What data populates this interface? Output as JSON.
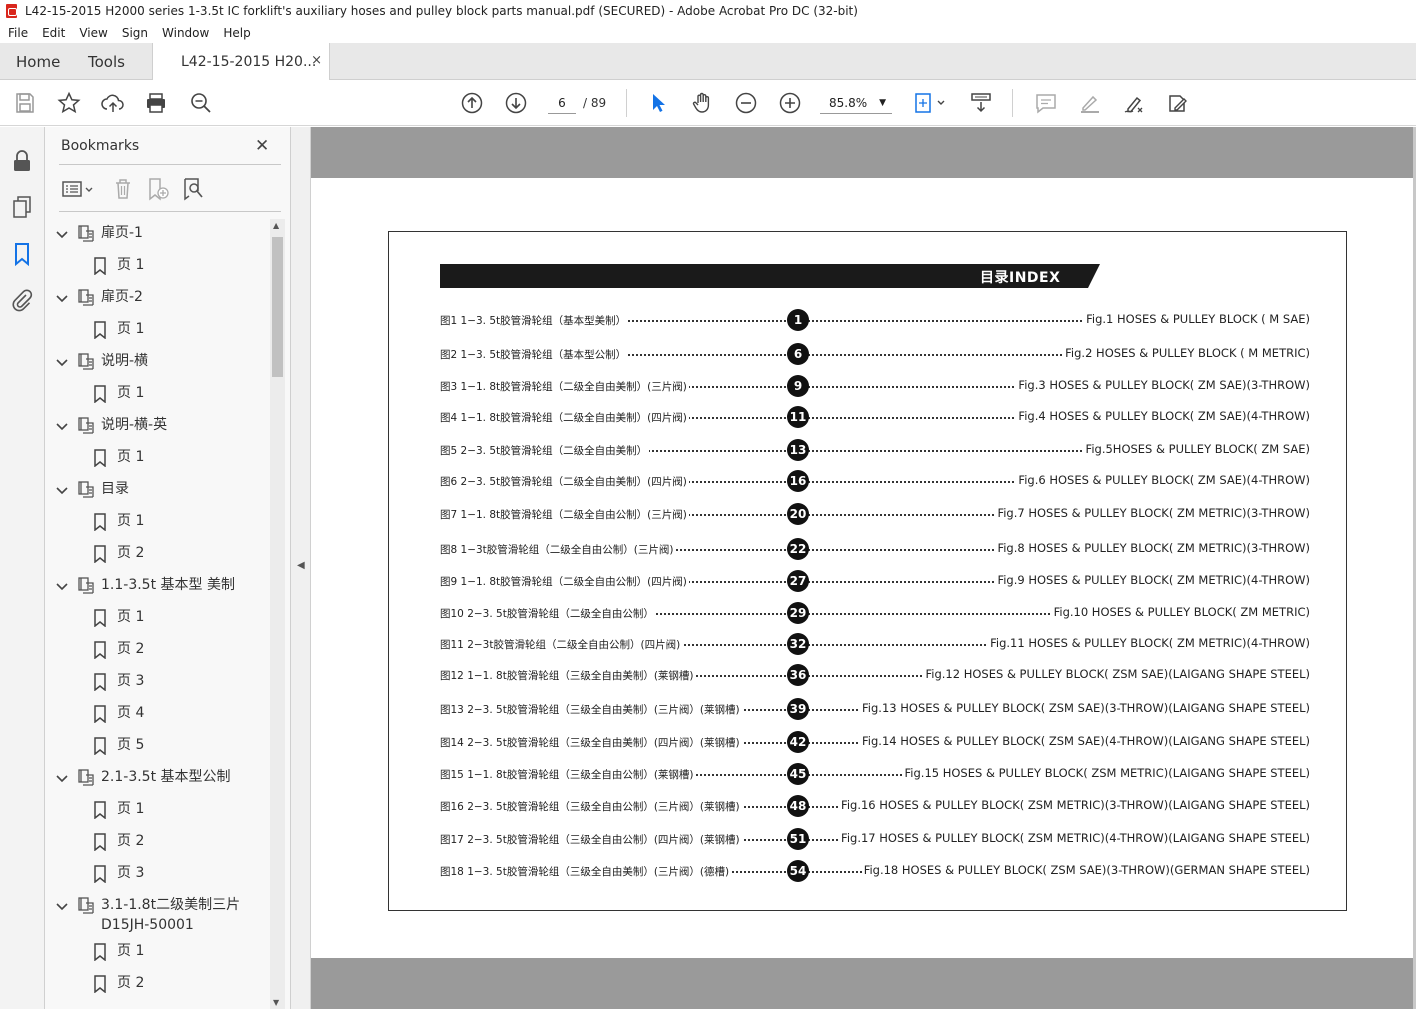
{
  "window": {
    "title": "L42-15-2015 H2000 series 1-3.5t IC forklift's auxiliary hoses and pulley block parts manual.pdf (SECURED) - Adobe Acrobat Pro DC (32-bit)"
  },
  "menu": [
    "File",
    "Edit",
    "View",
    "Sign",
    "Window",
    "Help"
  ],
  "tabs": {
    "home": "Home",
    "tools": "Tools",
    "document": "L42-15-2015 H20...",
    "close": "×"
  },
  "toolbar": {
    "page_current": "6",
    "page_total": "/ 89",
    "zoom": "85.8%"
  },
  "bookmarks": {
    "title": "Bookmarks",
    "items": [
      {
        "label": "扉页-1",
        "level": 0
      },
      {
        "label": "页 1",
        "level": 1
      },
      {
        "label": "扉页-2",
        "level": 0
      },
      {
        "label": "页 1",
        "level": 1
      },
      {
        "label": "说明-横",
        "level": 0
      },
      {
        "label": "页 1",
        "level": 1
      },
      {
        "label": "说明-横-英",
        "level": 0
      },
      {
        "label": "页 1",
        "level": 1
      },
      {
        "label": "目录",
        "level": 0
      },
      {
        "label": "页 1",
        "level": 1
      },
      {
        "label": "页 2",
        "level": 1
      },
      {
        "label": "1.1-3.5t 基本型 美制",
        "level": 0
      },
      {
        "label": "页 1",
        "level": 1
      },
      {
        "label": "页 2",
        "level": 1
      },
      {
        "label": "页 3",
        "level": 1
      },
      {
        "label": "页 4",
        "level": 1
      },
      {
        "label": "页 5",
        "level": 1
      },
      {
        "label": "2.1-3.5t 基本型公制",
        "level": 0
      },
      {
        "label": "页 1",
        "level": 1
      },
      {
        "label": "页 2",
        "level": 1
      },
      {
        "label": "页 3",
        "level": 1
      },
      {
        "label": "3.1-1.8t二级美制三片",
        "label2": "D15JH-50001",
        "level": 0
      },
      {
        "label": "页 1",
        "level": 1
      },
      {
        "label": "页 2",
        "level": 1
      }
    ]
  },
  "document": {
    "index_title": "目录INDEX",
    "entries": [
      {
        "cn": "图1  1−3. 5t胶管滑轮组（基本型美制）",
        "num": "1",
        "en": "Fig.1  HOSES & PULLEY BLOCK ( M SAE)"
      },
      {
        "cn": "图2  1−3. 5t胶管滑轮组（基本型公制）",
        "num": "6",
        "en": "Fig.2 HOSES & PULLEY BLOCK ( M METRIC)"
      },
      {
        "cn": "图3  1−1. 8t胶管滑轮组（二级全自由美制）(三片阀)",
        "num": "9",
        "en": "Fig.3 HOSES & PULLEY BLOCK( ZM SAE)(3-THROW)"
      },
      {
        "cn": "图4  1−1. 8t胶管滑轮组（二级全自由美制）(四片阀)",
        "num": "11",
        "en": "Fig.4 HOSES & PULLEY BLOCK( ZM SAE)(4-THROW)"
      },
      {
        "cn": "图5  2−3. 5t胶管滑轮组（二级全自由美制）",
        "num": "13",
        "en": "Fig.5HOSES & PULLEY BLOCK( ZM SAE)"
      },
      {
        "cn": "图6  2−3. 5t胶管滑轮组（二级全自由美制）(四片阀)",
        "num": "16",
        "en": "Fig.6 HOSES & PULLEY BLOCK( ZM SAE)(4-THROW)"
      },
      {
        "cn": "图7  1−1. 8t胶管滑轮组（二级全自由公制）(三片阀)",
        "num": "20",
        "en": "Fig.7 HOSES & PULLEY BLOCK( ZM METRIC)(3-THROW)"
      },
      {
        "cn": "图8  1−3t胶管滑轮组（二级全自由公制）(三片阀)",
        "num": "22",
        "en": "Fig.8 HOSES & PULLEY BLOCK( ZM METRIC)(3-THROW)"
      },
      {
        "cn": "图9  1−1. 8t胶管滑轮组（二级全自由公制）(四片阀)",
        "num": "27",
        "en": "Fig.9 HOSES & PULLEY BLOCK( ZM METRIC)(4-THROW)"
      },
      {
        "cn": "图10  2−3. 5t胶管滑轮组（二级全自由公制）",
        "num": "29",
        "en": "Fig.10 HOSES & PULLEY BLOCK( ZM METRIC)"
      },
      {
        "cn": "图11  2−3t胶管滑轮组（二级全自由公制）(四片阀)",
        "num": "32",
        "en": "Fig.11 HOSES & PULLEY BLOCK( ZM METRIC)(4-THROW)"
      },
      {
        "cn": "图12  1−1. 8t胶管滑轮组（三级全自由美制）(莱钢槽)",
        "num": "36",
        "en": "Fig.12 HOSES & PULLEY BLOCK( ZSM SAE)(LAIGANG SHAPE STEEL)"
      },
      {
        "cn": "图13  2−3. 5t胶管滑轮组（三级全自由美制）(三片阀）(莱钢槽)",
        "num": "39",
        "en": "Fig.13 HOSES & PULLEY BLOCK( ZSM SAE)(3-THROW)(LAIGANG SHAPE STEEL)"
      },
      {
        "cn": "图14  2−3. 5t胶管滑轮组（三级全自由美制）(四片阀）(莱钢槽)",
        "num": "42",
        "en": "Fig.14 HOSES & PULLEY BLOCK( ZSM SAE)(4-THROW)(LAIGANG SHAPE STEEL)"
      },
      {
        "cn": "图15  1−1. 8t胶管滑轮组（三级全自由公制）(莱钢槽)",
        "num": "45",
        "en": "Fig.15 HOSES & PULLEY BLOCK( ZSM METRIC)(LAIGANG SHAPE STEEL)"
      },
      {
        "cn": "图16  2−3. 5t胶管滑轮组（三级全自由公制）(三片阀）(莱钢槽)",
        "num": "48",
        "en": "Fig.16 HOSES & PULLEY BLOCK( ZSM METRIC)(3-THROW)(LAIGANG SHAPE STEEL)"
      },
      {
        "cn": "图17  2−3. 5t胶管滑轮组（三级全自由公制）(四片阀）(莱钢槽)",
        "num": "51",
        "en": "Fig.17 HOSES & PULLEY BLOCK( ZSM METRIC)(4-THROW)(LAIGANG SHAPE STEEL)"
      },
      {
        "cn": "图18  1−3. 5t胶管滑轮组（三级全自由美制）(三片阀）(德槽)",
        "num": "54",
        "en": "Fig.18 HOSES & PULLEY BLOCK( ZSM SAE)(3-THROW)(GERMAN SHAPE STEEL)"
      }
    ]
  }
}
